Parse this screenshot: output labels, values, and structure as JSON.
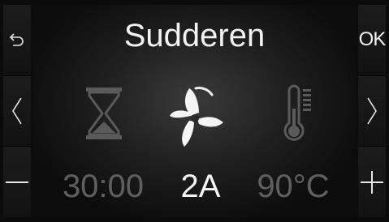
{
  "screen": {
    "title": "Sudderen"
  },
  "left_buttons": {
    "back_icon": "back-arrow-icon",
    "prev_icon": "chevron-left-icon",
    "minus_icon": "minus-icon"
  },
  "right_buttons": {
    "ok_label": "OK",
    "next_icon": "chevron-right-icon",
    "plus_icon": "plus-icon"
  },
  "settings": {
    "timer": {
      "icon": "hourglass-icon",
      "value": "30:00",
      "active": false
    },
    "power": {
      "icon": "mixer-blade-icon",
      "value": "2A",
      "active": true
    },
    "temperature": {
      "icon": "thermometer-icon",
      "value": "90°C",
      "active": false
    }
  },
  "colors": {
    "active": "#f4f4f4",
    "inactive": "#5f5f5f",
    "background": "#0b0b0b"
  }
}
